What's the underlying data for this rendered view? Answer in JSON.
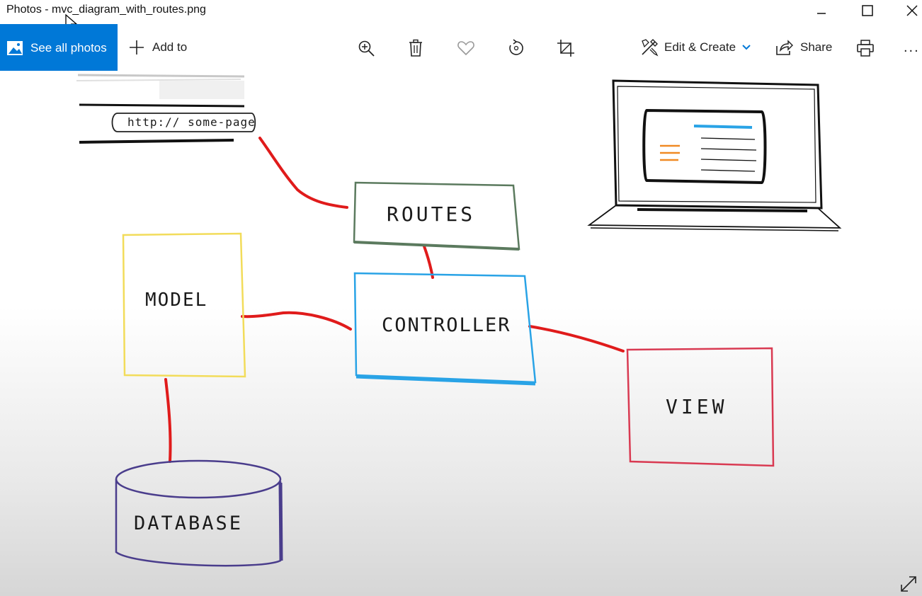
{
  "window": {
    "title": "Photos - mvc_diagram_with_routes.png"
  },
  "toolbar": {
    "see_all_label": "See all photos",
    "add_to_label": "Add to",
    "edit_create_label": "Edit & Create",
    "share_label": "Share",
    "more_label": "...",
    "icons": [
      "zoom-in-icon",
      "delete-icon",
      "favorite-icon",
      "rotate-icon",
      "crop-icon",
      "edit-icon",
      "share-icon",
      "print-icon"
    ]
  },
  "diagram": {
    "url_text": "http:// some-page",
    "routes_label": "ROUTES",
    "model_label": "MODEL",
    "controller_label": "CONTROLLER",
    "view_label": "VIEW",
    "database_label": "DATABASE"
  },
  "colors": {
    "accent": "#0078d7",
    "connector": "#e01b1b",
    "routes_box": "#5b7a5e",
    "model_box": "#f2dc5a",
    "controller_box": "#29a3e6",
    "view_box": "#d93a52",
    "database_box": "#4a3d8c"
  }
}
